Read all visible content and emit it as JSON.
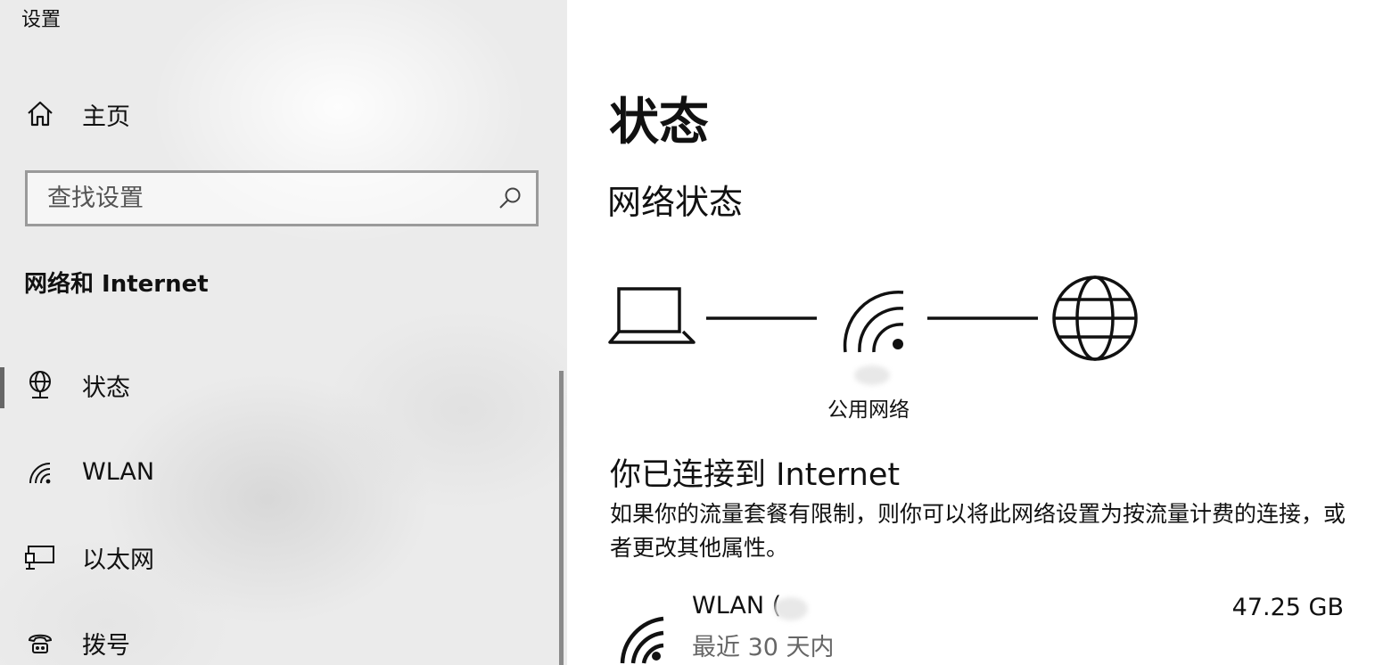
{
  "app": {
    "title": "设置"
  },
  "sidebar": {
    "home": {
      "label": "主页",
      "icon": "home-icon"
    },
    "search": {
      "placeholder": "查找设置",
      "icon": "search-icon"
    },
    "section_header": "网络和 Internet",
    "items": [
      {
        "label": "状态",
        "icon": "status-globe-icon",
        "active": true
      },
      {
        "label": "WLAN",
        "icon": "wifi-icon",
        "active": false
      },
      {
        "label": "以太网",
        "icon": "ethernet-icon",
        "active": false
      },
      {
        "label": "拨号",
        "icon": "dialup-icon",
        "active": false
      }
    ]
  },
  "main": {
    "page_title": "状态",
    "network_status_title": "网络状态",
    "diagram": {
      "network_name": "公用网络",
      "nodes": [
        "laptop-icon",
        "wifi-icon",
        "globe-icon"
      ]
    },
    "connected_title": "你已连接到 Internet",
    "connected_description": "如果你的流量套餐有限制，则你可以将此网络设置为按流量计费的连接，或者更改其他属性。",
    "connection": {
      "name": "WLAN (",
      "period": "最近 30 天内",
      "usage": "47.25 GB",
      "icon": "wifi-icon"
    }
  },
  "colors": {
    "sidebar_bg": "#ebebeb",
    "active_indicator": "#666666",
    "search_border": "#9a9a9a",
    "secondary_text": "#666666"
  }
}
